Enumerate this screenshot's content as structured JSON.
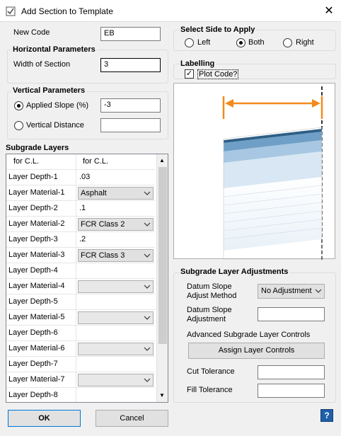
{
  "window": {
    "title": "Add Section to Template"
  },
  "new_code": {
    "label": "New Code",
    "value": "EB"
  },
  "horizontal": {
    "title": "Horizontal Parameters",
    "width_label": "Width of Section",
    "width_value": "3"
  },
  "vertical": {
    "title": "Vertical Parameters",
    "slope_label": "Applied Slope (%)",
    "slope_value": "-3",
    "distance_label": "Vertical Distance",
    "distance_value": "",
    "selected": "slope"
  },
  "side": {
    "title": "Select Side to Apply",
    "left": "Left",
    "both": "Both",
    "right": "Right",
    "selected": "both"
  },
  "labelling": {
    "title": "Labelling",
    "plot_code": "Plot Code?",
    "checked": true
  },
  "subgrade": {
    "title": "Subgrade Layers",
    "headers": [
      "for C.L.",
      "for C.L."
    ],
    "rows": [
      {
        "name": "Layer Depth-1",
        "value": ".03",
        "type": "text"
      },
      {
        "name": "Layer Material-1",
        "value": "Asphalt",
        "type": "combo"
      },
      {
        "name": "Layer Depth-2",
        "value": ".1",
        "type": "text"
      },
      {
        "name": "Layer Material-2",
        "value": "FCR Class 2",
        "type": "combo"
      },
      {
        "name": "Layer Depth-3",
        "value": ".2",
        "type": "text"
      },
      {
        "name": "Layer Material-3",
        "value": "FCR Class 3",
        "type": "combo"
      },
      {
        "name": "Layer Depth-4",
        "value": "",
        "type": "text"
      },
      {
        "name": "Layer Material-4",
        "value": "",
        "type": "combo"
      },
      {
        "name": "Layer Depth-5",
        "value": "",
        "type": "text"
      },
      {
        "name": "Layer Material-5",
        "value": "",
        "type": "combo"
      },
      {
        "name": "Layer Depth-6",
        "value": "",
        "type": "text"
      },
      {
        "name": "Layer Material-6",
        "value": "",
        "type": "combo"
      },
      {
        "name": "Layer Depth-7",
        "value": "",
        "type": "text"
      },
      {
        "name": "Layer Material-7",
        "value": "",
        "type": "combo"
      },
      {
        "name": "Layer Depth-8",
        "value": "",
        "type": "text"
      }
    ]
  },
  "adjust": {
    "title": "Subgrade Layer Adjustments",
    "method_label_1": "Datum Slope",
    "method_label_2": "Adjust Method",
    "method_value": "No Adjustment",
    "adj_label_1": "Datum Slope",
    "adj_label_2": "Adjustment",
    "adj_value": "",
    "advanced": "Advanced Subgrade Layer Controls",
    "assign_button": "Assign Layer Controls",
    "cut_label": "Cut Tolerance",
    "cut_value": "",
    "fill_label": "Fill Tolerance",
    "fill_value": ""
  },
  "buttons": {
    "ok": "OK",
    "cancel": "Cancel",
    "help": "?"
  },
  "colors": {
    "dim_arrow": "#f28a1e",
    "layer_top": "#2f5f86",
    "layer_mid": "#7aa9cf"
  }
}
